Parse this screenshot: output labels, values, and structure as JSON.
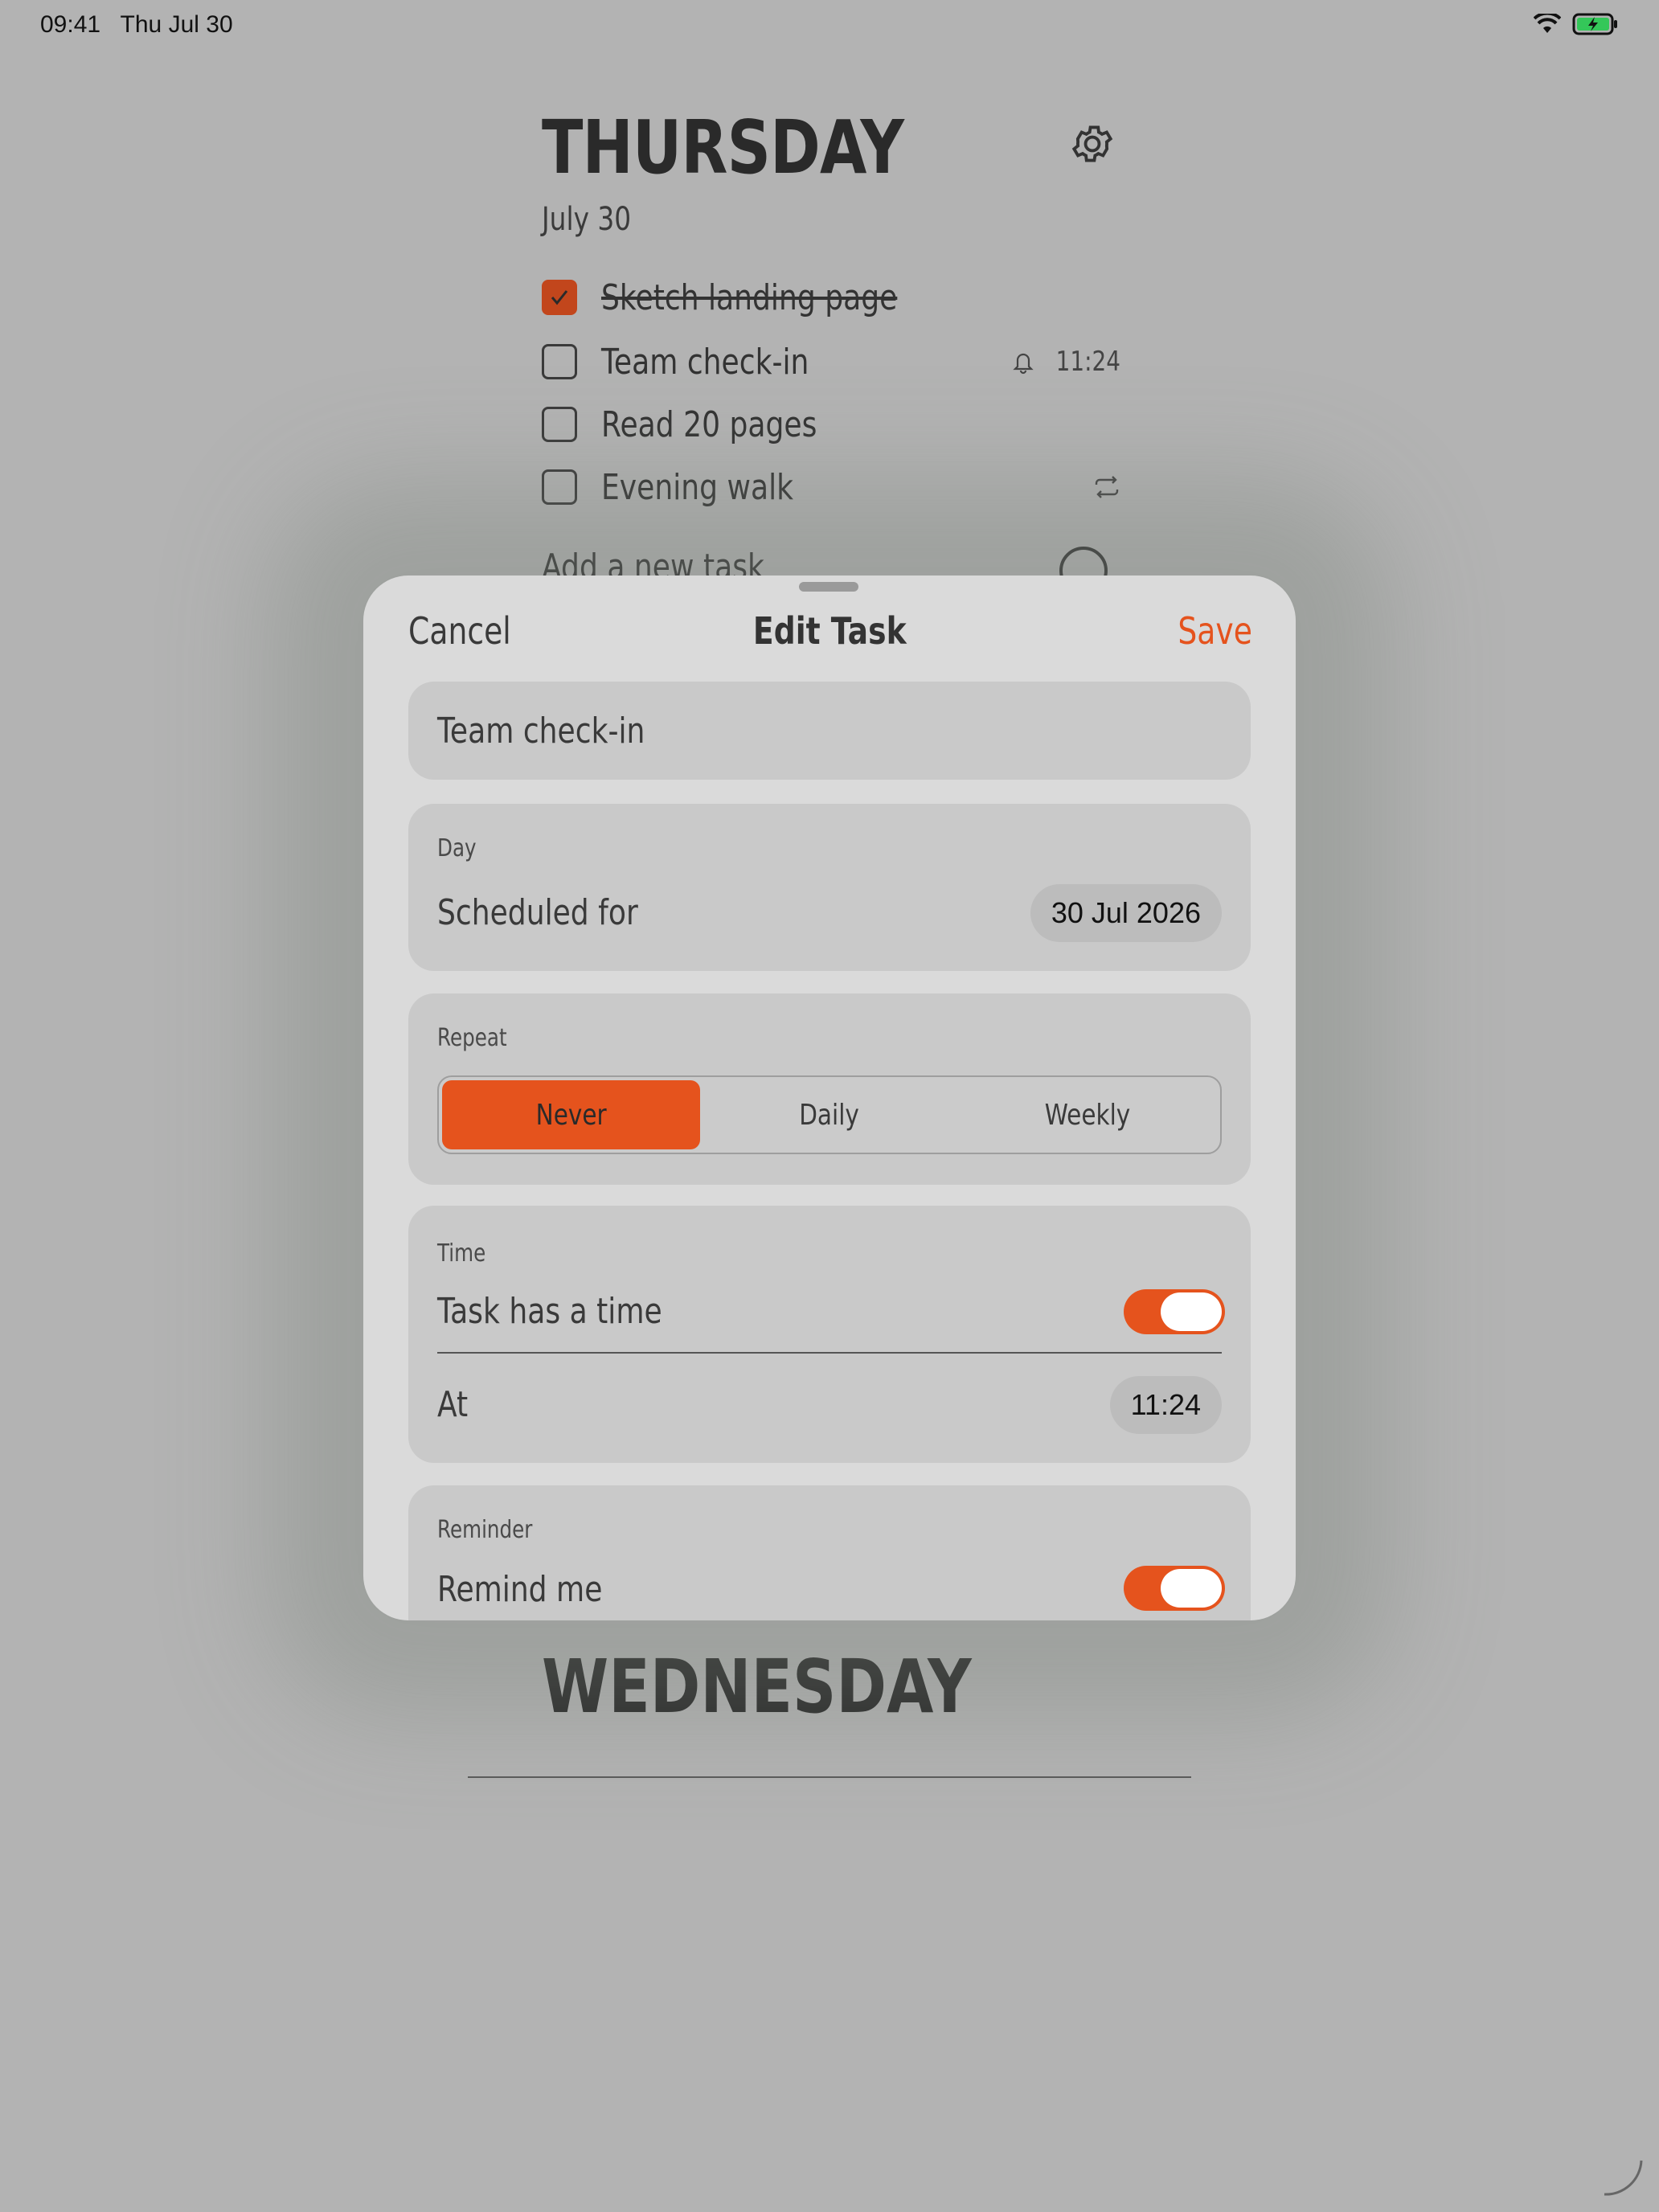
{
  "status_bar": {
    "time": "09:41",
    "date": "Thu Jul 30"
  },
  "background": {
    "day_title": "THURSDAY",
    "day_date": "July 30",
    "tasks": [
      {
        "label": "Sketch landing page",
        "done": true
      },
      {
        "label": "Team check-in",
        "done": false,
        "reminder_time": "11:24"
      },
      {
        "label": "Read 20 pages",
        "done": false
      },
      {
        "label": "Evening walk",
        "done": false,
        "repeats": true
      }
    ],
    "add_placeholder": "Add a new task",
    "next_day_title": "WEDNESDAY"
  },
  "sheet": {
    "cancel_label": "Cancel",
    "title": "Edit Task",
    "save_label": "Save",
    "task_name": "Team check-in",
    "day_section": {
      "label": "Day",
      "row_label": "Scheduled for",
      "value": "30 Jul 2026"
    },
    "repeat_section": {
      "label": "Repeat",
      "options": [
        "Never",
        "Daily",
        "Weekly"
      ],
      "selected": "Never"
    },
    "time_section": {
      "label": "Time",
      "toggle_label": "Task has a time",
      "toggle_on": true,
      "at_label": "At",
      "time_value": "11:24"
    },
    "reminder_section": {
      "label": "Reminder",
      "toggle_label": "Remind me",
      "toggle_on": true
    }
  },
  "colors": {
    "accent": "#e5531d",
    "checked": "#c2461c",
    "backdrop": "#b3b3b3",
    "sheet": "#dadada",
    "card": "#c9c9c9"
  }
}
